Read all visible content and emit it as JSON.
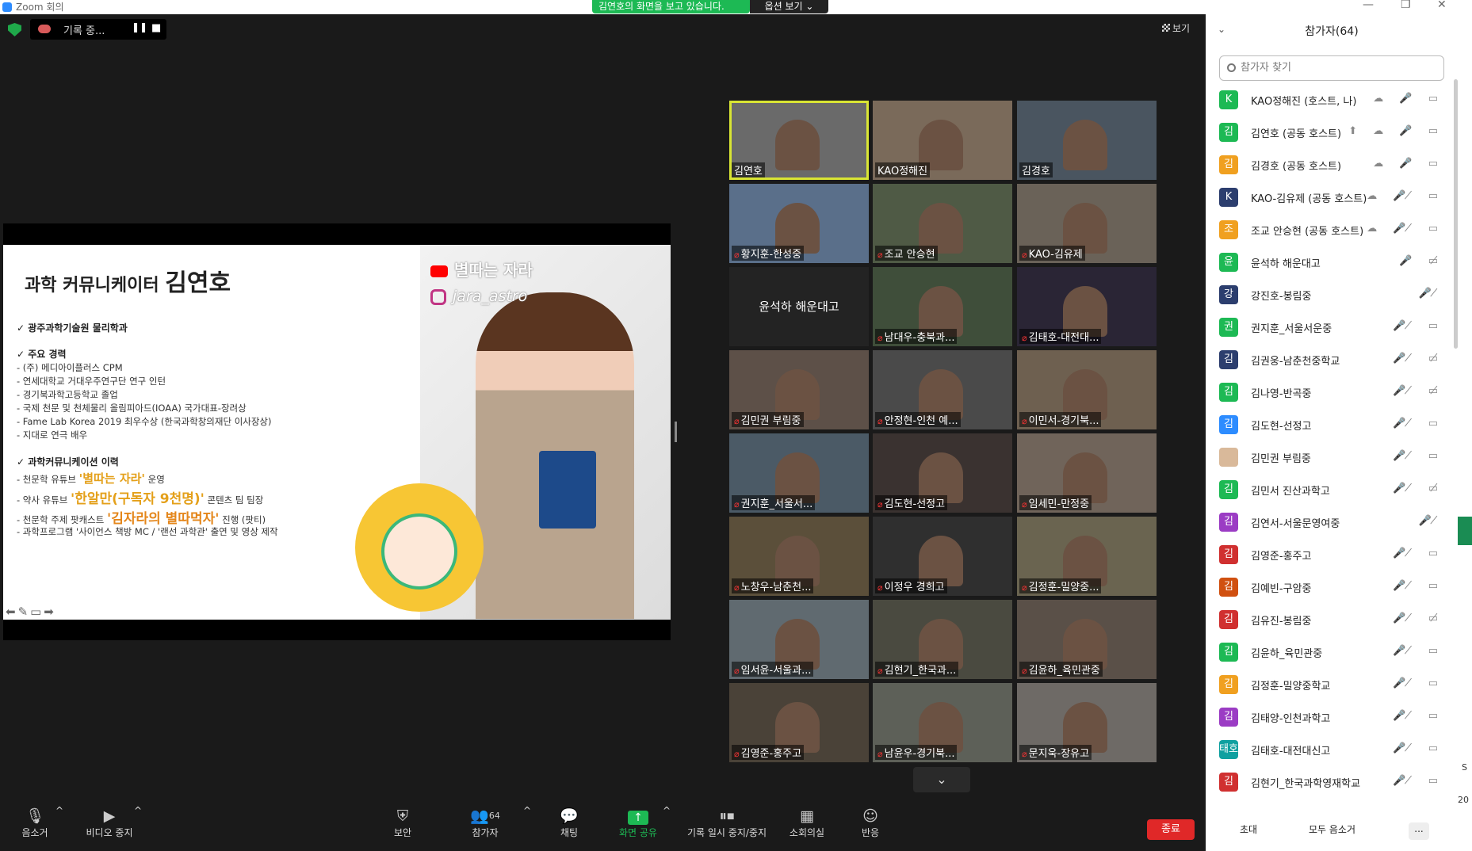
{
  "window": {
    "title": "Zoom 회의"
  },
  "banner": {
    "text": "김연호의 화면을 보고 있습니다.",
    "view_options": "옵션 보기 ⌄"
  },
  "recording": {
    "label": "기록 중...",
    "pause": "❚❚",
    "stop": "■"
  },
  "view_button": "보기",
  "slide": {
    "title_prefix": "과학 커뮤니케이터 ",
    "title_name": "김연호",
    "youtube": "별따는 자라",
    "instagram": "jara_astro",
    "s1": "✓  광주과학기술원 물리학과",
    "s2": "✓  주요 경력",
    "career": [
      "- (주) 메디아이플러스 CPM",
      "- 연세대학교 거대우주연구단 연구 인턴",
      "- 경기북과학고등학교 졸업",
      "- 국제 천문 및 천체물리 올림피아드(IOAA) 국가대표-장려상",
      "- Fame Lab Korea 2019 최우수상 (한국과학창의재단 이사장상)",
      "-   지대로 연극 배우"
    ],
    "s3": "✓  과학커뮤니케이션 이력",
    "hist1_pre": "- 천문학 유튜브 ",
    "hist1_em": "'별따는 자라'",
    "hist1_post": " 운영",
    "hist2_pre": "- 약사 유튜브 ",
    "hist2_em": "'한알만(구독자 9천명)'",
    "hist2_post": " 콘텐츠 팀 팀장",
    "hist3_pre": "- 천문학 주제 팟캐스트 ",
    "hist3_em": "'김자라의 별따먹자'",
    "hist3_post": " 진행 (팟티)",
    "hist4": "- 과학프로그램 '사이언스 책방 MC / '랜선 과학관' 출연 및 영상 제작",
    "controls": "⬅✎▭➡"
  },
  "video_tiles": [
    {
      "name": "김연호",
      "muted": false,
      "active": true
    },
    {
      "name": "KAO정해진",
      "muted": false
    },
    {
      "name": "김경호",
      "muted": false
    },
    {
      "name": "황지훈-한성중",
      "muted": true
    },
    {
      "name": "조교 안승현",
      "muted": true
    },
    {
      "name": "KAO-김유제",
      "muted": true
    },
    {
      "name": "윤석하 해운대고",
      "muted": false,
      "name_only": true
    },
    {
      "name": "남대우-충북과...",
      "muted": true
    },
    {
      "name": "김태호-대전대...",
      "muted": true
    },
    {
      "name": "김민권 부림중",
      "muted": true
    },
    {
      "name": "안정현-인천 예...",
      "muted": true
    },
    {
      "name": "이민서-경기북...",
      "muted": true
    },
    {
      "name": "권지훈_서울서...",
      "muted": true
    },
    {
      "name": "김도현-선정고",
      "muted": true
    },
    {
      "name": "임세민-만정중",
      "muted": true
    },
    {
      "name": "노창우-남춘천...",
      "muted": true
    },
    {
      "name": "이정우 경희고",
      "muted": true
    },
    {
      "name": "김정훈-밀양중...",
      "muted": true
    },
    {
      "name": "임서윤-서울과...",
      "muted": true
    },
    {
      "name": "김현기_한국과...",
      "muted": true
    },
    {
      "name": "김윤하_육민관중",
      "muted": true
    },
    {
      "name": "김영준-홍주고",
      "muted": true
    },
    {
      "name": "남윤우-경기북...",
      "muted": true
    },
    {
      "name": "문지욱-장유고",
      "muted": true
    }
  ],
  "scroll_down": "⌄",
  "toolbar": {
    "mute": "음소거",
    "video": "비디오 중지",
    "security": "보안",
    "participants": "참가자",
    "participants_count": "64",
    "chat": "채팅",
    "share": "화면 공유",
    "record": "기록 일시 중지/중지",
    "breakout": "소회의실",
    "reactions": "반응",
    "end": "종료"
  },
  "panel": {
    "title": "참가자(64)",
    "search_placeholder": "참가자 찾기",
    "participants": [
      {
        "avatar": "K",
        "color": "#1db954",
        "name": "KAO정해진 (호스트, 나)",
        "icons": "☁ 🎤 ▭"
      },
      {
        "avatar": "김",
        "color": "#1db954",
        "name": "김연호 (공동 호스트)",
        "icons": "⬆ ☁ 🎤 ▭",
        "share": true
      },
      {
        "avatar": "김",
        "color": "#f0a020",
        "name": "김경호 (공동 호스트)",
        "icons": "☁ 🎤 ▭"
      },
      {
        "avatar": "K",
        "color": "#2c3e6e",
        "name": "KAO-김유제 (공동 호스트)",
        "icons": "☁ 🎤̸ ▭",
        "muted": true
      },
      {
        "avatar": "조",
        "color": "#f0a020",
        "name": "조교 안승현 (공동 호스트)",
        "icons": "☁ 🎤̸ ▭",
        "muted": true
      },
      {
        "avatar": "윤",
        "color": "#1db954",
        "name": "윤석하 해운대고",
        "icons": "🎤 ▭̸"
      },
      {
        "avatar": "강",
        "color": "#2c3e6e",
        "name": "강진호-봉림중",
        "icons": "🎤̸",
        "muted": true
      },
      {
        "avatar": "권",
        "color": "#1db954",
        "name": "권지훈_서울서운중",
        "icons": "🎤̸ ▭",
        "muted": true
      },
      {
        "avatar": "김",
        "color": "#2c3e6e",
        "name": "김권웅-남춘천중학교",
        "icons": "🎤̸ ▭̸",
        "muted": true
      },
      {
        "avatar": "김",
        "color": "#1db954",
        "name": "김나영-반곡중",
        "icons": "🎤̸ ▭̸",
        "muted": true
      },
      {
        "avatar": "김",
        "color": "#2d8cff",
        "name": "김도현-선정고",
        "icons": "🎤̸ ▭",
        "muted": true
      },
      {
        "avatar": "",
        "color": "#d9b99a",
        "name": "김민권 부림중",
        "icons": "🎤̸ ▭",
        "muted": true
      },
      {
        "avatar": "김",
        "color": "#1db954",
        "name": "김민서 진산과학고",
        "icons": "🎤̸ ▭̸",
        "muted": true
      },
      {
        "avatar": "김",
        "color": "#9b3cc4",
        "name": "김연서-서울문영여중",
        "icons": "🎤̸",
        "muted": true
      },
      {
        "avatar": "김",
        "color": "#d03030",
        "name": "김영준-홍주고",
        "icons": "🎤̸ ▭",
        "muted": true
      },
      {
        "avatar": "김",
        "color": "#d05010",
        "name": "김예빈-구암중",
        "icons": "🎤̸ ▭",
        "muted": true
      },
      {
        "avatar": "김",
        "color": "#d03030",
        "name": "김유진-봉림중",
        "icons": "🎤̸ ▭̸",
        "muted": true
      },
      {
        "avatar": "김",
        "color": "#1db954",
        "name": "김윤하_육민관중",
        "icons": "🎤̸ ▭",
        "muted": true
      },
      {
        "avatar": "김",
        "color": "#f0a020",
        "name": "김정훈-밀양중학교",
        "icons": "🎤̸ ▭",
        "muted": true
      },
      {
        "avatar": "김",
        "color": "#9b3cc4",
        "name": "김태양-인천과학고",
        "icons": "🎤̸ ▭",
        "muted": true
      },
      {
        "avatar": "태호",
        "color": "#0fa0a0",
        "name": "김태호-대전대신고",
        "icons": "🎤̸ ▭",
        "muted": true
      },
      {
        "avatar": "김",
        "color": "#d03030",
        "name": "김현기_한국과학영재학교",
        "icons": "🎤̸ ▭",
        "muted": true
      }
    ],
    "invite": "초대",
    "mute_all": "모두 음소거",
    "more": "..."
  },
  "edge_text": [
    "S",
    "20"
  ]
}
